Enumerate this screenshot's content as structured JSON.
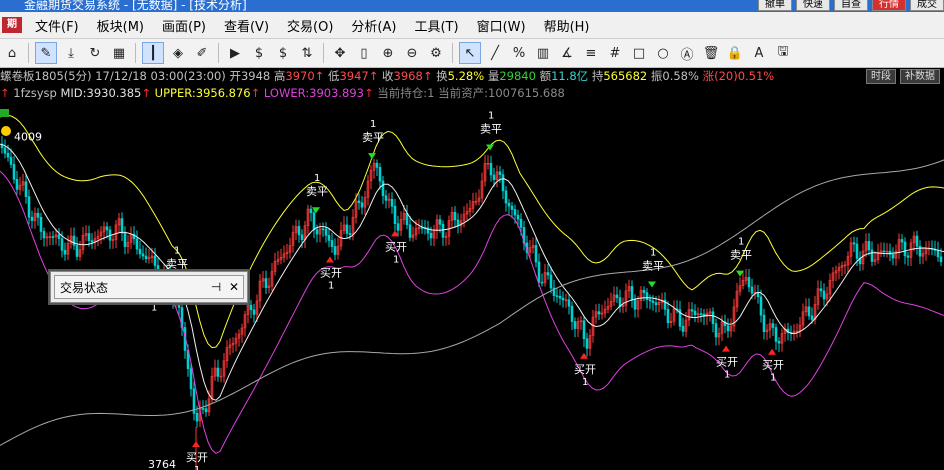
{
  "window": {
    "title": "金融期货交易系统 - [无数据] - [技术分析]",
    "top_buttons": [
      "撤单",
      "快速",
      "自查",
      "行情",
      "成交"
    ]
  },
  "menubar": {
    "items": [
      {
        "label": "文件(F)"
      },
      {
        "label": "板块(M)"
      },
      {
        "label": "画面(P)"
      },
      {
        "label": "查看(V)"
      },
      {
        "label": "交易(O)"
      },
      {
        "label": "分析(A)"
      },
      {
        "label": "工具(T)"
      },
      {
        "label": "窗口(W)"
      },
      {
        "label": "帮助(H)"
      }
    ]
  },
  "toolbar": {
    "icons": [
      "home-icon",
      "pencil-icon",
      "download-icon",
      "refresh-icon",
      "layout-icon",
      "candlestick-icon",
      "diamond-icon",
      "edit-icon",
      "play-icon",
      "dollar-icon",
      "dollar-dropdown-icon",
      "swap-icon",
      "move-icon",
      "bar-icon",
      "zoom-in-icon",
      "zoom-out-icon",
      "settings-icon",
      "cursor-icon",
      "line-icon",
      "percent-icon",
      "grid-tool-icon",
      "fib-icon",
      "level-icon",
      "hash-icon",
      "rect-icon",
      "circle-icon",
      "text-icon",
      "trash-icon",
      "lock-icon",
      "font-color-icon",
      "save-icon"
    ]
  },
  "infobar": {
    "symbol": "螺卷板1805(5分)",
    "datetime": "17/12/18 03:00(23:00)",
    "open_label": "开",
    "open": "3948",
    "high_label": "高",
    "high": "3970",
    "low_label": "低",
    "low": "3947",
    "close_label": "收",
    "close": "3968",
    "turnover_label": "换",
    "turnover": "5.28%",
    "volume_label": "量",
    "volume": "29840",
    "amount_label": "额",
    "amount": "11.8亿",
    "hold_label": "持",
    "hold": "565682",
    "amp_label": "振",
    "amp": "0.58%",
    "rise_label": "涨(20)",
    "rise": "0.51%",
    "btn_period": "时段",
    "btn_fill": "补数据"
  },
  "indicator": {
    "name": "1fzsysp",
    "mid_label": "MID:",
    "mid": "3930.385",
    "upper_label": "UPPER:",
    "upper": "3956.876",
    "lower_label": "LOWER:",
    "lower": "3903.893",
    "pos_label": "当前持仓:",
    "pos": "1",
    "asset_label": "当前资产:",
    "asset": "1007615.688"
  },
  "chart_data": {
    "type": "line",
    "ylim": [
      3740,
      4040
    ],
    "high_label": "4009",
    "low_label": "3764",
    "colors": {
      "mid": "#f0f0f0",
      "upper": "#ffff33",
      "lower": "#e040e0",
      "equity": "#a8a8a8",
      "up": "#ff3b3b",
      "down": "#00d0d0",
      "buy": "#ff2222",
      "sell": "#22dd22"
    },
    "signal_sell_text": "卖平",
    "signal_buy_text": "买开",
    "signal_qty": "1",
    "sell_signals": [
      176,
      316,
      372,
      490,
      652,
      740
    ],
    "buy_signals": [
      153,
      196,
      330,
      395,
      584,
      726,
      772
    ]
  },
  "trade_status": {
    "title": "交易状态",
    "pin": "⊣",
    "close": "✕"
  }
}
